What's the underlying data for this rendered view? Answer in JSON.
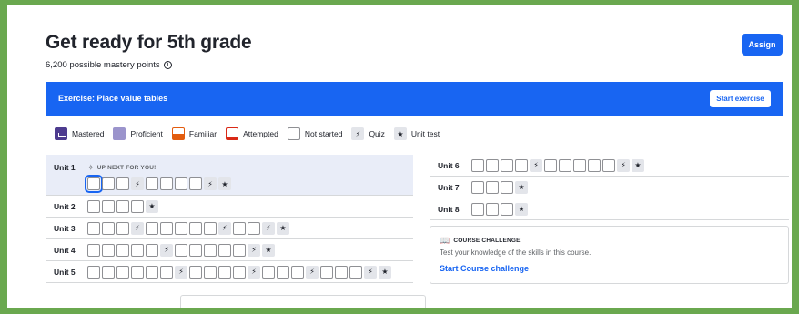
{
  "header": {
    "title": "Get ready for 5th grade",
    "subtitle": "6,200 possible mastery points",
    "assign_label": "Assign"
  },
  "banner": {
    "text": "Exercise: Place value tables",
    "button_label": "Start exercise"
  },
  "legend": {
    "mastered": "Mastered",
    "proficient": "Proficient",
    "familiar": "Familiar",
    "attempted": "Attempted",
    "not_started": "Not started",
    "quiz": "Quiz",
    "unit_test": "Unit test"
  },
  "icons": {
    "quiz": "⚡",
    "unit_test": "★",
    "info": "i",
    "sparkle": "✧",
    "book": "📖"
  },
  "up_next": "UP NEXT FOR YOU!",
  "units_left": [
    {
      "label": "Unit 1",
      "items": [
        "s",
        "s",
        "s",
        "q",
        "s",
        "s",
        "s",
        "s",
        "q",
        "t"
      ],
      "up_next": true
    },
    {
      "label": "Unit 2",
      "items": [
        "s",
        "s",
        "s",
        "s",
        "t"
      ]
    },
    {
      "label": "Unit 3",
      "items": [
        "s",
        "s",
        "s",
        "q",
        "s",
        "s",
        "s",
        "s",
        "s",
        "q",
        "s",
        "s",
        "q",
        "t"
      ]
    },
    {
      "label": "Unit 4",
      "items": [
        "s",
        "s",
        "s",
        "s",
        "s",
        "q",
        "s",
        "s",
        "s",
        "s",
        "s",
        "q",
        "t"
      ]
    },
    {
      "label": "Unit 5",
      "items": [
        "s",
        "s",
        "s",
        "s",
        "s",
        "s",
        "q",
        "s",
        "s",
        "s",
        "s",
        "q",
        "s",
        "s",
        "s",
        "q",
        "s",
        "s",
        "s",
        "q",
        "t"
      ]
    }
  ],
  "units_right": [
    {
      "label": "Unit 6",
      "items": [
        "s",
        "s",
        "s",
        "s",
        "q",
        "s",
        "s",
        "s",
        "s",
        "s",
        "q",
        "t"
      ]
    },
    {
      "label": "Unit 7",
      "items": [
        "s",
        "s",
        "s",
        "t"
      ]
    },
    {
      "label": "Unit 8",
      "items": [
        "s",
        "s",
        "s",
        "t"
      ]
    }
  ],
  "challenge": {
    "heading": "COURSE CHALLENGE",
    "description": "Test your knowledge of the skills in this course.",
    "link": "Start Course challenge"
  },
  "colors": {
    "brand_blue": "#1865f2",
    "mastered": "#4d3b8f",
    "proficient": "#9b94cc",
    "familiar": "#e35c0e",
    "attempted": "#d92916",
    "page_border": "#6aa84f"
  }
}
